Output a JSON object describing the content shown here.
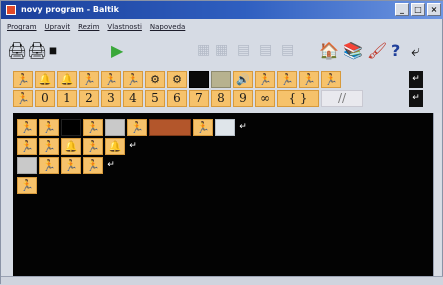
{
  "window": {
    "title": "novy program - Baltik",
    "controls": [
      "_",
      "□",
      "×"
    ]
  },
  "menu": [
    "Program",
    "Upravit",
    "Rezim",
    "Vlastnosti",
    "Napoveda"
  ],
  "toolbar": {
    "icons": [
      "🖨",
      "🖨",
      "⏹"
    ],
    "run_icon": "▶",
    "disabled_icons": [
      "▦",
      "▦",
      "▤",
      "▤",
      "▤"
    ],
    "right_icons": [
      "🏠",
      "📚",
      "🖌",
      "?",
      "⤶"
    ]
  },
  "palette": {
    "row1": [
      "🏃",
      "🔔",
      "🔔",
      "🏃",
      "🏃",
      "🏃",
      "⚙",
      "⚙",
      "",
      "",
      "🔊",
      "🏃",
      "🏃",
      "🏃",
      "🏃"
    ],
    "row2": [
      "🏃",
      "0",
      "1",
      "2",
      "3",
      "4",
      "5",
      "6",
      "7",
      "8",
      "9",
      "∞",
      "{ }",
      "//"
    ]
  },
  "canvas": {
    "row1": [
      "🏃",
      "🏃",
      "",
      "🏃",
      "",
      "🏃",
      "",
      "🏃",
      ""
    ],
    "row2": [
      "🏃",
      "🏃",
      "🔔",
      "🏃",
      "🔔"
    ],
    "row3": [
      "",
      "🏃",
      "🏃",
      "🏃"
    ],
    "row4": [
      "🏃"
    ],
    "arrow": "↵"
  },
  "colors": {
    "palette_cell": "#f6c26b",
    "canvas_bg": "#030303",
    "run_icon": "#3aa83a",
    "title_gradient_start": "#1b3f9a"
  }
}
